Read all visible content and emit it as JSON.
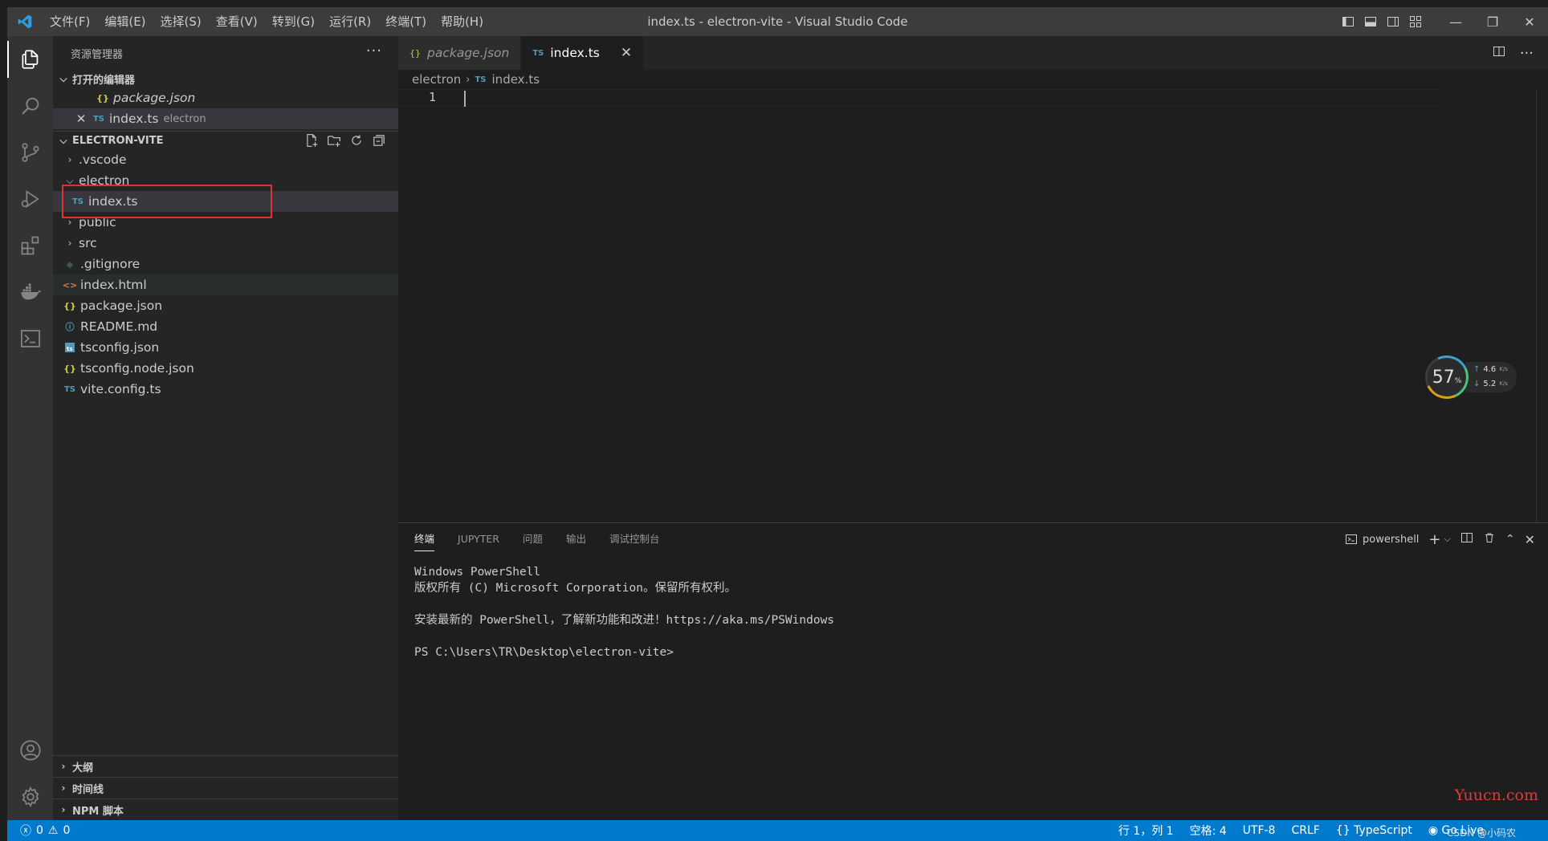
{
  "window": {
    "title": "index.ts - electron-vite - Visual Studio Code",
    "menu": [
      "文件(F)",
      "编辑(E)",
      "选择(S)",
      "查看(V)",
      "转到(G)",
      "运行(R)",
      "终端(T)",
      "帮助(H)"
    ],
    "minimize": "—",
    "restore": "❐",
    "close": "✕"
  },
  "activity": {
    "icons": [
      "explorer-icon",
      "search-icon",
      "source-control-icon",
      "run-debug-icon",
      "extensions-icon",
      "docker-icon",
      "terminal-icon"
    ],
    "bottom_icons": [
      "account-icon",
      "settings-icon"
    ]
  },
  "sidebar": {
    "title": "资源管理器",
    "more": "···",
    "open_editors": {
      "header": "打开的编辑器",
      "items": [
        {
          "icon": "{}",
          "name": "package.json",
          "desc": ""
        },
        {
          "icon": "TS",
          "name": "index.ts",
          "desc": "electron"
        }
      ]
    },
    "project": {
      "header": "ELECTRON-VITE",
      "items": [
        {
          "type": "folder",
          "open": false,
          "name": ".vscode"
        },
        {
          "type": "folder",
          "open": true,
          "name": "electron"
        },
        {
          "type": "ts",
          "name": "index.ts"
        },
        {
          "type": "folder",
          "open": false,
          "name": "public"
        },
        {
          "type": "folder",
          "open": false,
          "name": "src"
        },
        {
          "type": "git",
          "name": ".gitignore"
        },
        {
          "type": "html",
          "name": "index.html"
        },
        {
          "type": "json",
          "name": "package.json"
        },
        {
          "type": "md",
          "name": "README.md"
        },
        {
          "type": "tsconfig",
          "name": "tsconfig.json"
        },
        {
          "type": "json",
          "name": "tsconfig.node.json"
        },
        {
          "type": "ts",
          "name": "vite.config.ts"
        }
      ]
    },
    "bottom_sections": [
      "大纲",
      "时间线",
      "NPM 脚本"
    ]
  },
  "editor": {
    "tabs": [
      {
        "icon": "{}",
        "label": "package.json",
        "active": false
      },
      {
        "icon": "TS",
        "label": "index.ts",
        "active": true,
        "close": "✕"
      }
    ],
    "breadcrumb": {
      "folder": "electron",
      "sep": "›",
      "icon": "TS",
      "file": "index.ts"
    },
    "line_number": "1"
  },
  "network_widget": {
    "percent": "57",
    "percent_unit": "%",
    "up": "4.6",
    "down": "5.2",
    "unit": "K/s"
  },
  "panel": {
    "tabs": [
      "终端",
      "JUPYTER",
      "问题",
      "输出",
      "调试控制台"
    ],
    "terminal_type": "powershell",
    "terminal_lines": [
      "Windows PowerShell",
      "版权所有 (C) Microsoft Corporation。保留所有权利。",
      "",
      "安装最新的 PowerShell，了解新功能和改进！https://aka.ms/PSWindows",
      "",
      "PS C:\\Users\\TR\\Desktop\\electron-vite>"
    ]
  },
  "statusbar": {
    "errors": "0",
    "warnings": "0",
    "position": "行 1，列 1",
    "spaces": "空格: 4",
    "encoding": "UTF-8",
    "eol": "CRLF",
    "language": "TypeScript",
    "golive": "Go Live"
  },
  "watermark": "Yuucn.com",
  "csdn": "CSDN @小码农"
}
